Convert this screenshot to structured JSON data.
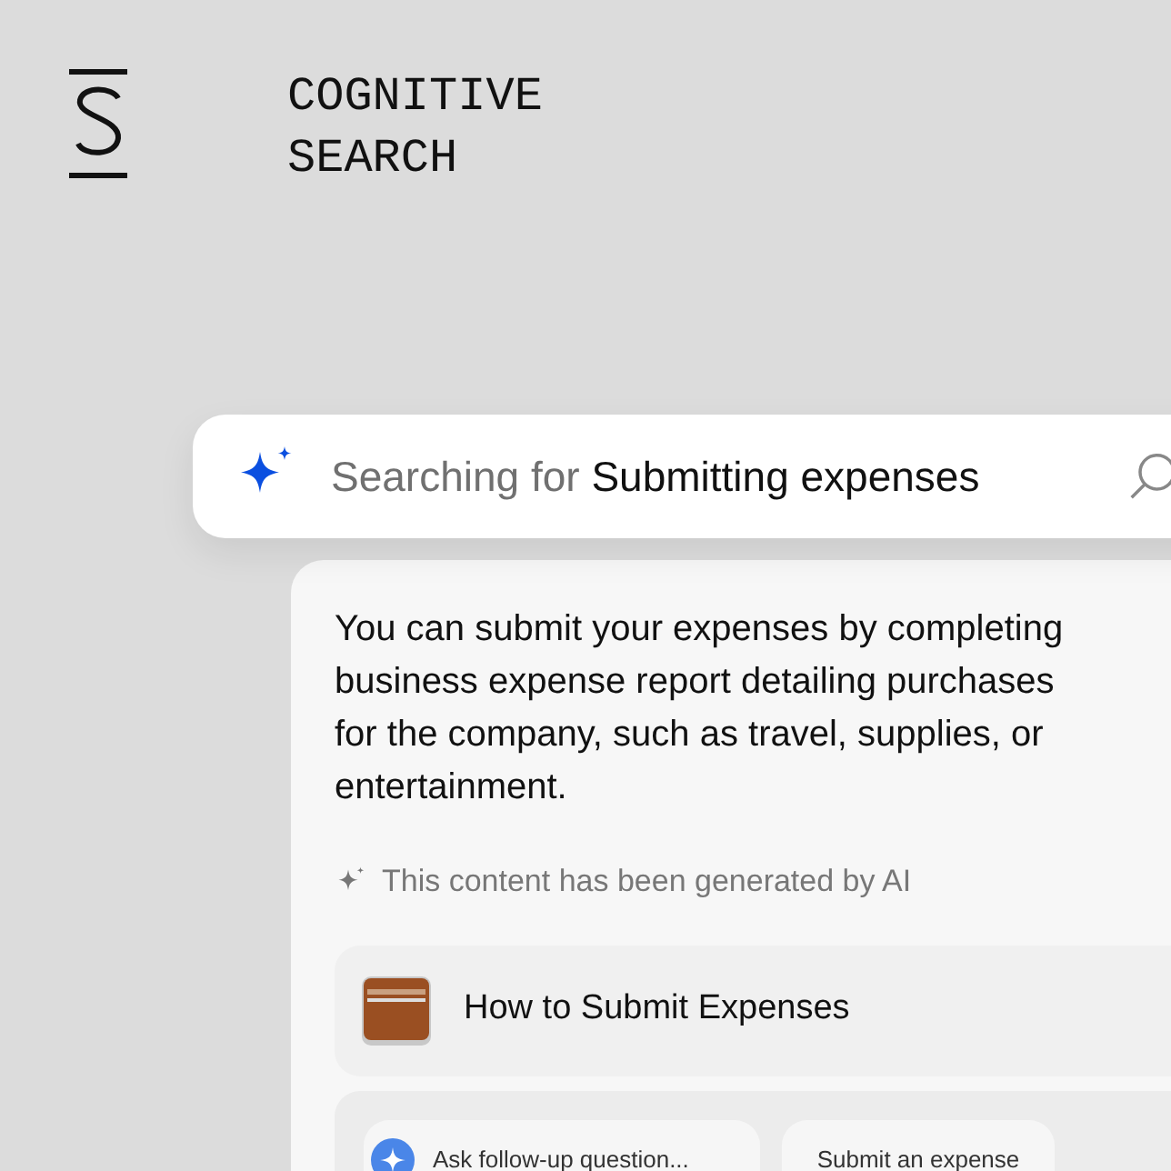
{
  "brand": {
    "title_lines": [
      "COGNITIVE",
      "SEARCH"
    ]
  },
  "search": {
    "prefix": "Searching for",
    "query": "Submitting expenses"
  },
  "answer": {
    "lines": [
      "You can submit your expenses by completing",
      "business expense report detailing purchases",
      "for the company, such as travel, supplies, or",
      "entertainment."
    ],
    "disclaimer": "This content has been generated by AI"
  },
  "resource": {
    "title": "How to Submit Expenses"
  },
  "actions": [
    {
      "kind": "ask",
      "label": "Ask follow-up question..."
    },
    {
      "kind": "suggestion",
      "label": "Submit an expense"
    }
  ]
}
